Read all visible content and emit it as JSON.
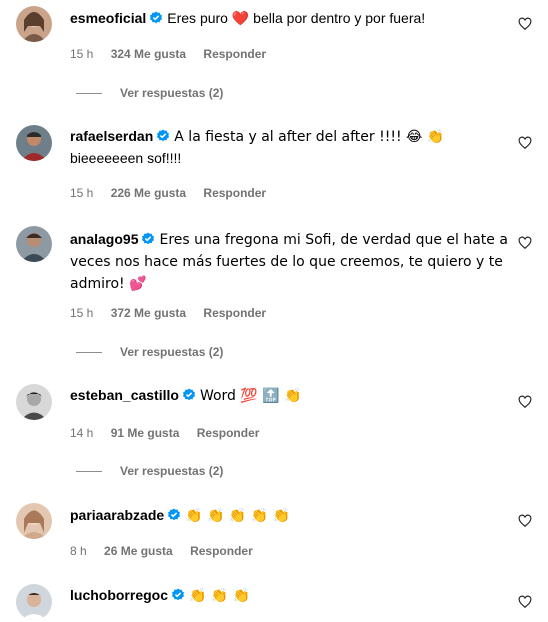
{
  "comments": [
    {
      "username": "esmeoficial",
      "text_parts": [
        "Eres puro ",
        "❤️",
        " bella por dentro y por fuera!"
      ],
      "time": "15 h",
      "likes": "324 Me gusta",
      "reply": "Responder",
      "view_replies": "Ver respuestas (2)"
    },
    {
      "username": "rafaelserdan",
      "text_line1": "A la fiesta y al after del after !!!! 😂 👏",
      "text_line2": "bieeeeeeen sof!!!!",
      "time": "15 h",
      "likes": "226 Me gusta",
      "reply": "Responder"
    },
    {
      "username": "analago95",
      "text": "Eres una fregona mi Sofi, de verdad que el hate a veces nos hace más fuertes de lo que creemos, te quiero y te admiro! 💕",
      "time": "15 h",
      "likes": "372 Me gusta",
      "reply": "Responder",
      "view_replies": "Ver respuestas (2)"
    },
    {
      "username": "esteban_castillo",
      "text": "Word 💯 🔝 👏",
      "time": "14 h",
      "likes": "91 Me gusta",
      "reply": "Responder",
      "view_replies": "Ver respuestas (2)"
    },
    {
      "username": "pariaarabzade",
      "text": "👏 👏 👏 👏 👏",
      "time": "8 h",
      "likes": "26 Me gusta",
      "reply": "Responder"
    },
    {
      "username": "luchoborregoc",
      "text": "👏 👏 👏"
    }
  ],
  "colors": {
    "verified": "#0095f6",
    "secondary_text": "#737373",
    "heart_red": "#ed4956"
  }
}
